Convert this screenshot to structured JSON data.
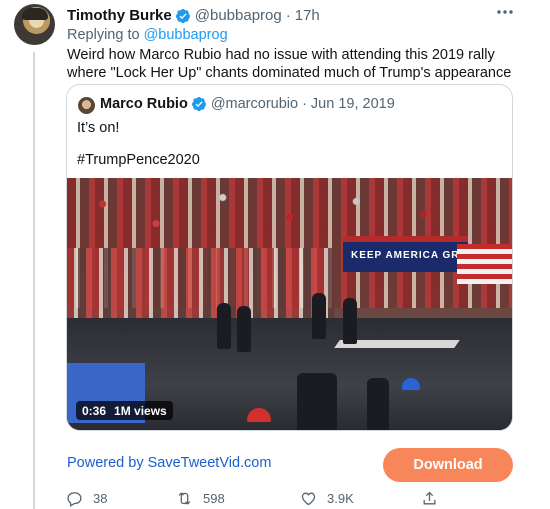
{
  "tweet": {
    "author_name": "Timothy Burke",
    "handle": "@bubbaprog",
    "separator": "·",
    "time": "17h",
    "replying_prefix": "Replying to",
    "replying_to": "@bubbaprog",
    "text": "Weird how Marco Rubio had no issue with attending this 2019 rally where \"Lock Her Up\" chants dominated much of Trump's appearance"
  },
  "quoted": {
    "author_name": "Marco Rubio",
    "handle": "@marcorubio",
    "separator": "·",
    "date": "Jun 19, 2019",
    "line1": "It’s on!",
    "line2": "#TrumpPence2020",
    "video": {
      "duration": "0:36",
      "views": "1M views",
      "banner_text": "KEEP AMERICA GRE"
    }
  },
  "promo": {
    "powered_by": "Powered by SaveTweetVid.com",
    "download_label": "Download",
    "download_color": "#f7875a"
  },
  "actions": {
    "reply_count": "38",
    "retweet_count": "598",
    "like_count": "3.9K",
    "share_label": ""
  },
  "icons": [
    "verified-icon",
    "more-icon",
    "reply-icon",
    "retweet-icon",
    "like-icon",
    "share-icon"
  ],
  "colors": {
    "link": "#1d9bf0",
    "muted": "#536471",
    "verified": "#1d9bf0"
  }
}
